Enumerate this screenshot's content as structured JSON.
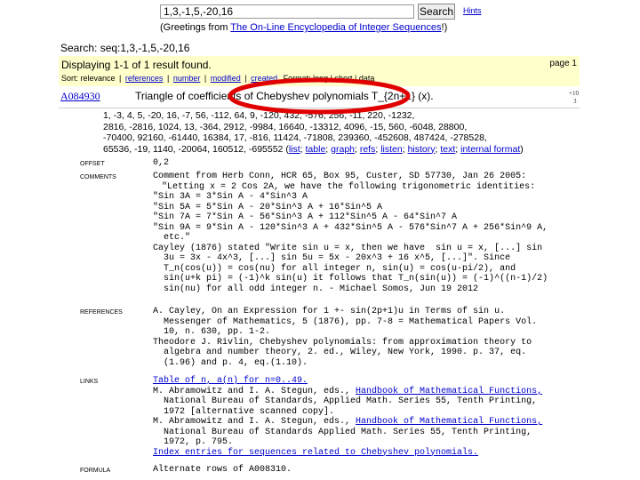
{
  "header": {
    "search_value": "1,3,-1,5,-20,16",
    "search_button": "Search",
    "hints": "Hints",
    "greeting_prefix": "(Greetings from ",
    "greeting_link": "The On-Line Encyclopedia of Integer Sequences",
    "greeting_suffix": "!)"
  },
  "search_line": "Search: seq:1,3,-1,5,-20,16",
  "results": {
    "displaying": "Displaying 1-1 of 1 result found.",
    "page": "page 1",
    "sort_label": "Sort: relevance",
    "sort_options": [
      "references",
      "number",
      "modified",
      "created"
    ],
    "format_fragment": "Format: long | short | data"
  },
  "sequence": {
    "id": "A084930",
    "title": "Triangle of coefficients of Chebyshev polynomials T_{2n+1} (x).",
    "side_1": "+10",
    "side_2": "3",
    "values": [
      "1, -3, 4, 5, -20, 16, -7, 56, -112, 64, 9, -120, 432, -576, 256, -11, 220, -1232,",
      "2816, -2816, 1024, 13, -364, 2912, -9984, 16640, -13312, 4096, -15, 560, -6048, 28800,",
      "-70400, 92160, -61440, 16384, 17, -816, 11424, -71808, 239360, -452608, 487424, -278528,",
      "65536, -19, 1140, -20064, 160512, -695552"
    ],
    "values_links": [
      "list",
      "table",
      "graph",
      "refs",
      "listen",
      "history",
      "text",
      "internal format"
    ]
  },
  "fields": {
    "offset_label": "OFFSET",
    "offset_value": "0,2",
    "comments_label": "COMMENTS",
    "comments": [
      "Comment from Herb Conn, HCR 65, Box 95, Custer, SD 57730, Jan 26 2005:",
      "\"Letting x = 2 Cos 2A, we have the following trigonometric identities:",
      "\"Sin 3A = 3*Sin A - 4*Sin^3 A",
      "\"Sin 5A = 5*Sin A - 20*Sin^3 A + 16*Sin^5 A",
      "\"Sin 7A = 7*Sin A - 56*Sin^3 A + 112*Sin^5 A - 64*Sin^7 A",
      "\"Sin 9A = 9*Sin A - 120*Sin^3 A + 432*Sin^5 A - 576*Sin^7 A + 256*Sin^9 A,",
      "  etc.\"",
      "Cayley (1876) stated \"Write sin u = x, then we have  sin u = x, [...] sin",
      "  3u = 3x - 4x^3, [...] sin 5u = 5x - 20x^3 + 16 x^5, [...]\". Since",
      "  T_n(cos(u)) = cos(nu) for all integer n, sin(u) = cos(u-pi/2), and",
      "  sin(u+k pi) = (-1)^k sin(u) it follows that T_n(sin(u)) = (-1)^((n-1)/2)",
      "  sin(nu) for all odd integer n. - Michael Somos, Jun 19 2012"
    ],
    "references_label": "REFERENCES",
    "references": [
      "A. Cayley, On an Expression for 1 +- sin(2p+1)u in Terms of sin u.",
      "  Messenger of Mathematics, 5 (1876), pp. 7-8 = Mathematical Papers Vol.",
      "  10, n. 630, pp. 1-2.",
      "Theodore J. Rivlin, Chebyshev polynomials: from approximation theory to",
      "  algebra and number theory, 2. ed., Wiley, New York, 1990. p. 37, eq.",
      "  (1.96) and p. 4, eq.(1.10)."
    ],
    "links_label": "LINKS",
    "links": [
      {
        "text": "Table of n, a(n) for n=0..49.",
        "link": true
      },
      {
        "text": "M. Abramowitz and I. A. Stegun, eds., ",
        "link": false,
        "tail": "Handbook of Mathematical Functions,"
      },
      {
        "text": "  National Bureau of Standards, Applied Math. Series 55, Tenth Printing,",
        "link": false
      },
      {
        "text": "  1972 [alternative scanned copy].",
        "link": false
      },
      {
        "text": "M. Abramowitz and I. A. Stegun, eds., ",
        "link": false,
        "tail": "Handbook of Mathematical Functions,"
      },
      {
        "text": "  National Bureau of Standards Applied Math. Series 55, Tenth Printing,",
        "link": false
      },
      {
        "text": "  1972, p. 795.",
        "link": false
      },
      {
        "text": "Index entries for sequences related to Chebyshev polynomials.",
        "link": true
      }
    ],
    "formula_label": "FORMULA",
    "formula": "Alternate rows of A008310."
  },
  "colors": {
    "results_bg": "#ffffcc",
    "link": "#0000cc",
    "annotation": "#e00000"
  }
}
